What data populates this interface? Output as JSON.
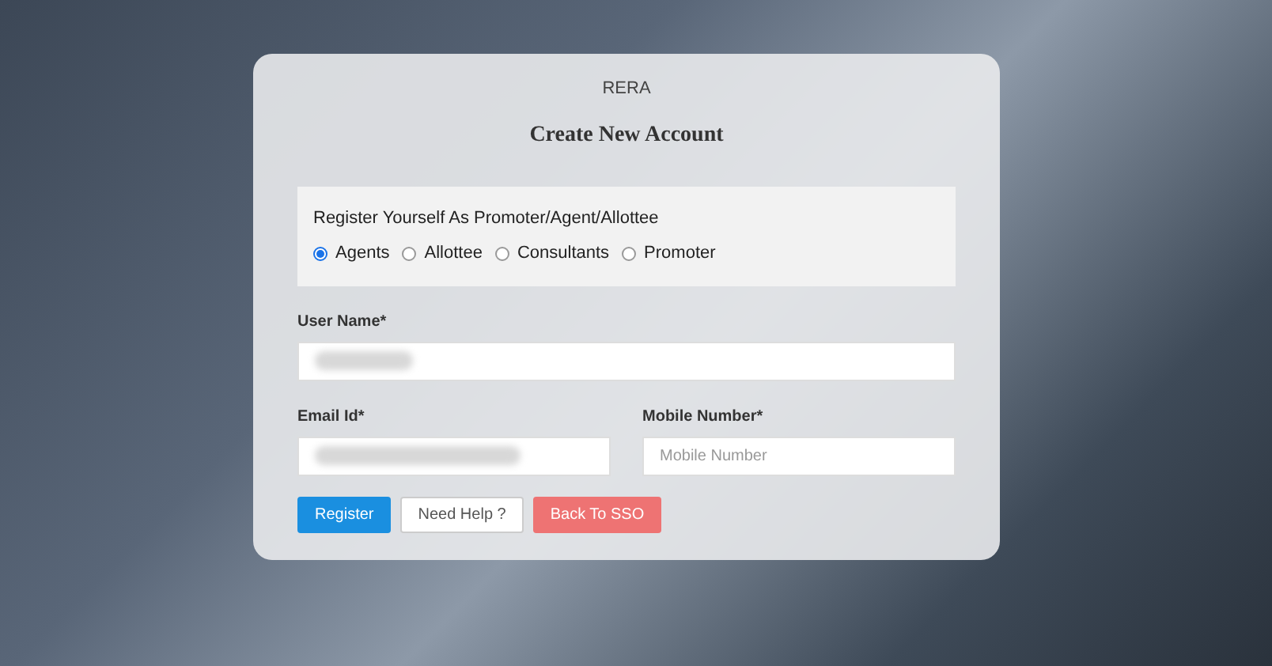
{
  "brand": "RERA",
  "title": "Create New Account",
  "role_group": {
    "label": "Register Yourself As Promoter/Agent/Allottee",
    "options": [
      {
        "label": "Agents",
        "selected": true
      },
      {
        "label": "Allottee",
        "selected": false
      },
      {
        "label": "Consultants",
        "selected": false
      },
      {
        "label": "Promoter",
        "selected": false
      }
    ]
  },
  "fields": [
    {
      "label": "User Name*",
      "redacted": true,
      "kind": "wide"
    },
    {
      "label": "Email Id*",
      "redacted": true,
      "kind": "narrow"
    },
    {
      "label": "Mobile Number*",
      "placeholder": "Mobile Number",
      "redacted": false,
      "kind": "narrow"
    }
  ],
  "buttons": [
    {
      "label": "Register",
      "kind": "primary"
    },
    {
      "label": "Need Help ?",
      "kind": "default"
    },
    {
      "label": "Back To SSO",
      "kind": "danger"
    }
  ]
}
